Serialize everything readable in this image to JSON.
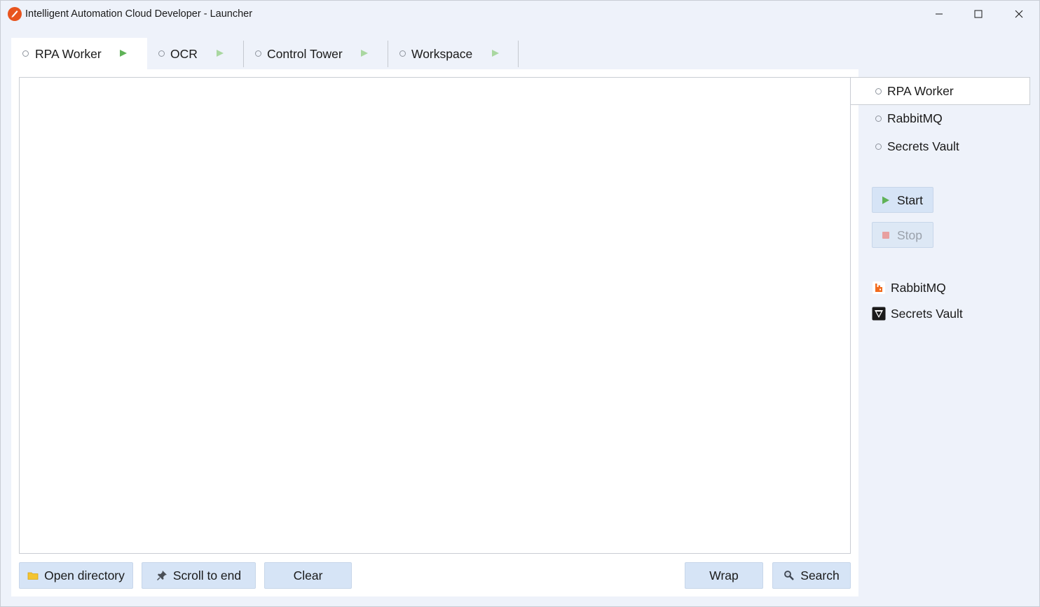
{
  "window": {
    "title": "Intelligent Automation Cloud Developer - Launcher"
  },
  "tabs": [
    {
      "label": "RPA Worker",
      "active": true
    },
    {
      "label": "OCR",
      "active": false
    },
    {
      "label": "Control Tower",
      "active": false
    },
    {
      "label": "Workspace",
      "active": false
    }
  ],
  "log": {
    "content": ""
  },
  "toolbar": {
    "open_directory": "Open directory",
    "scroll_to_end": "Scroll to end",
    "clear": "Clear",
    "wrap": "Wrap",
    "search": "Search"
  },
  "sidebar": {
    "services": [
      {
        "label": "RPA Worker",
        "selected": true
      },
      {
        "label": "RabbitMQ",
        "selected": false
      },
      {
        "label": "Secrets Vault",
        "selected": false
      }
    ],
    "start_label": "Start",
    "stop_label": "Stop",
    "links": [
      {
        "label": "RabbitMQ",
        "icon": "rabbitmq-icon"
      },
      {
        "label": "Secrets Vault",
        "icon": "vault-icon"
      }
    ]
  },
  "colors": {
    "accent_button": "#d6e4f6",
    "play_green": "#5fb257",
    "stop_red": "#e8a0a0",
    "window_bg": "#eef2fa"
  }
}
